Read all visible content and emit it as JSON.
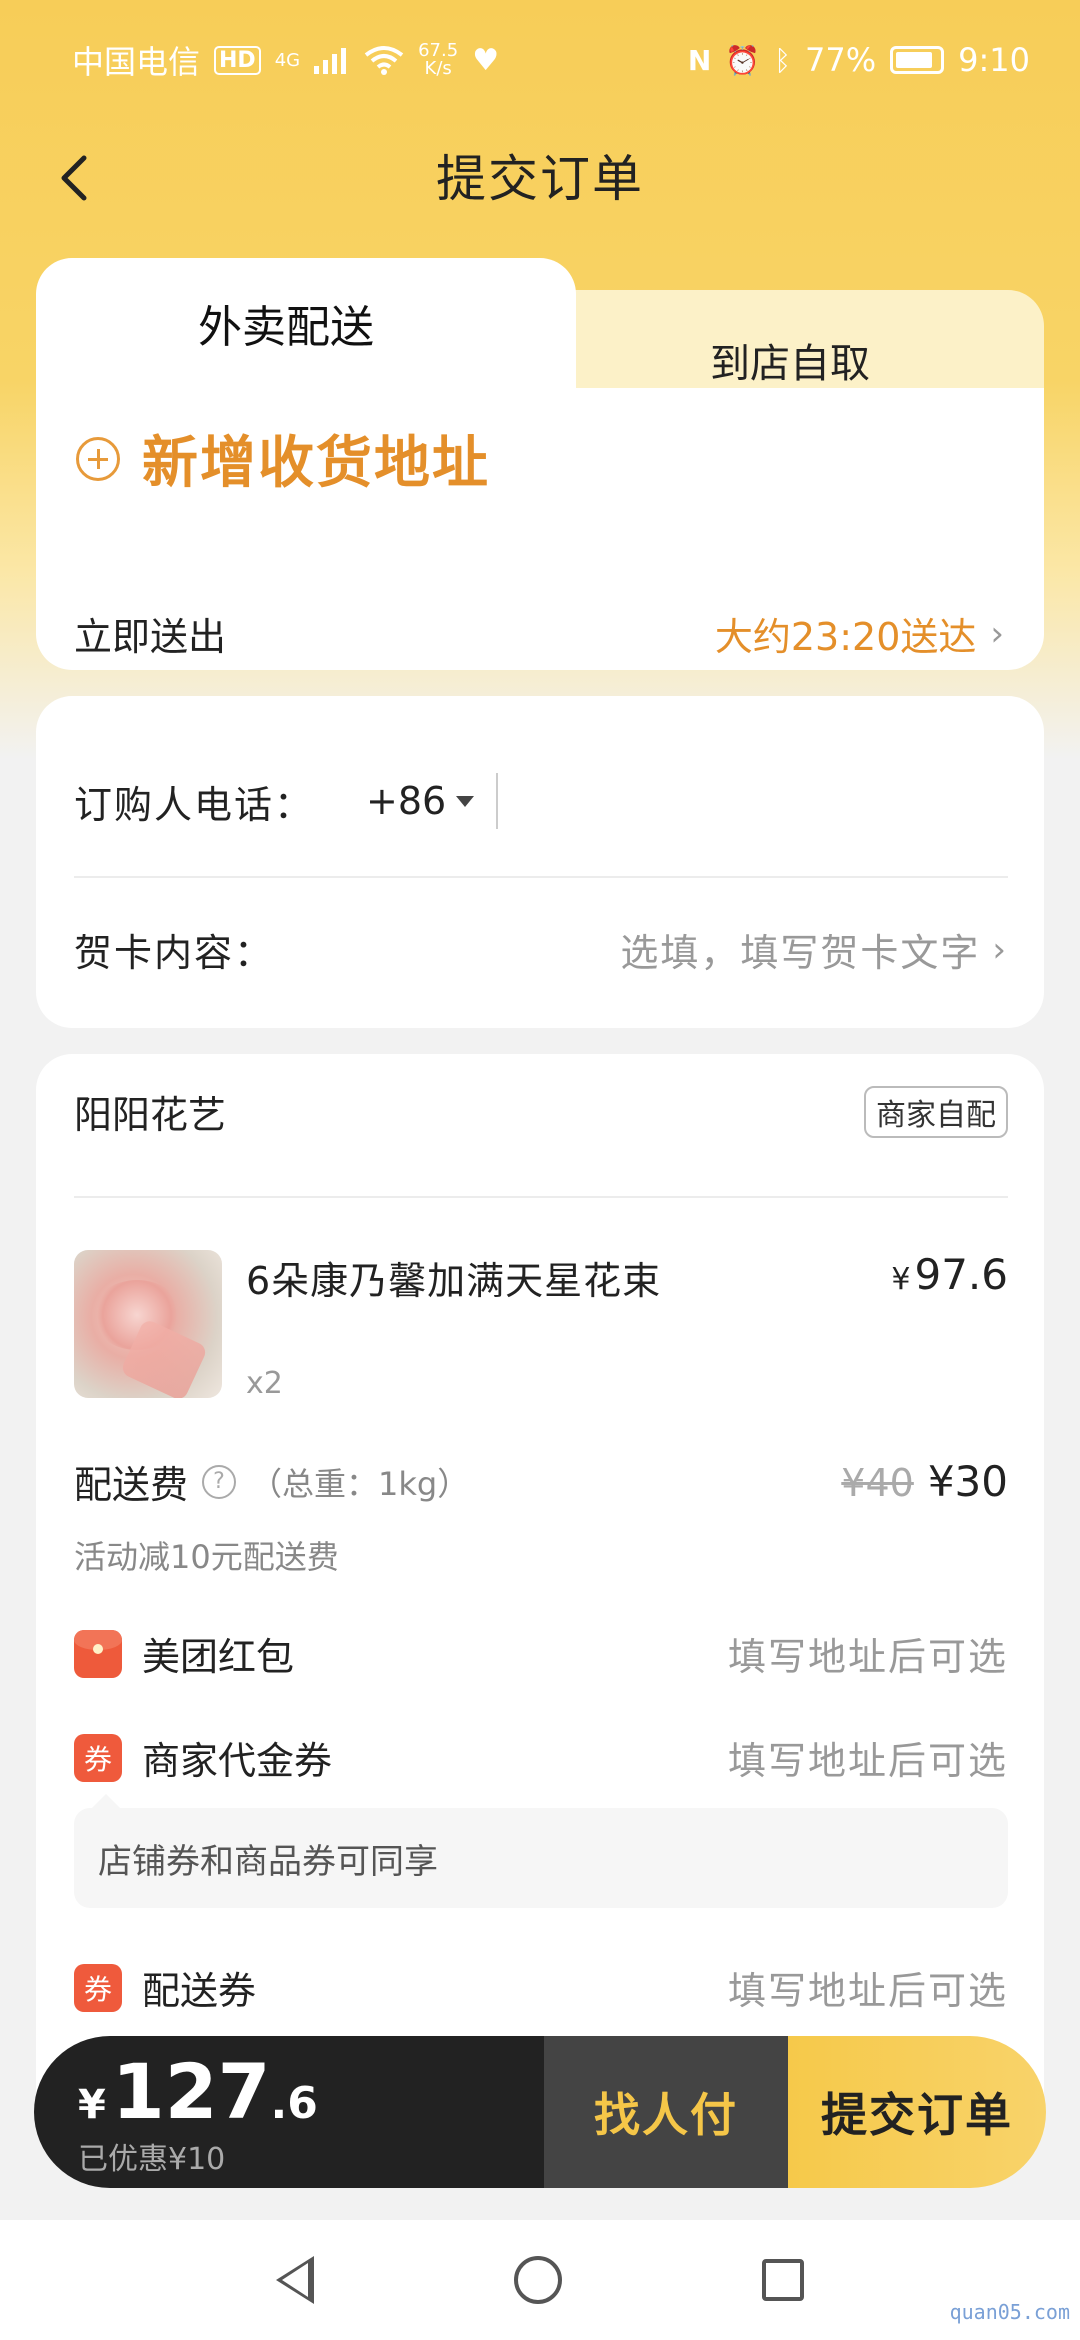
{
  "status_bar": {
    "carrier": "中国电信",
    "hd": "HD",
    "network": "4G",
    "speed_value": "67.5",
    "speed_unit": "K/s",
    "battery": "77%",
    "time": "9:10"
  },
  "header": {
    "title": "提交订单"
  },
  "delivery": {
    "tab_active": "外卖配送",
    "tab_inactive": "到店自取",
    "add_address": "新增收货地址",
    "deliver_now": "立即送出",
    "eta": "大约23:20送达"
  },
  "contact": {
    "phone_label": "订购人电话：",
    "phone_prefix": "+86",
    "card_label": "贺卡内容：",
    "card_placeholder": "选填，填写贺卡文字"
  },
  "order": {
    "shop_name": "阳阳花艺",
    "shop_badge": "商家自配",
    "product": {
      "name": "6朵康乃馨加满天星花束",
      "qty": "x2",
      "price_symbol": "¥",
      "price": "97.6"
    },
    "delivery_fee": {
      "label": "配送费",
      "help_icon": "?",
      "weight": "（总重：1kg）",
      "original": "¥40",
      "current": "¥30",
      "note": "活动减10元配送费"
    },
    "coupons": [
      {
        "icon": "red-packet-icon",
        "label": "美团红包",
        "status": "填写地址后可选"
      },
      {
        "icon": "coupon-icon",
        "icon_text": "券",
        "label": "商家代金券",
        "status": "填写地址后可选"
      },
      {
        "icon": "coupon-icon",
        "icon_text": "券",
        "label": "配送券",
        "status": "填写地址后可选"
      }
    ],
    "tip": "店铺券和商品券可同享"
  },
  "bottom_bar": {
    "yen": "¥",
    "total_int": "127",
    "total_dec": ".6",
    "saved": "已优惠¥10",
    "find_pay": "找人付",
    "submit": "提交订单"
  },
  "watermark": "quan05.com",
  "colors": {
    "brand_yellow": "#f7cd58",
    "accent_orange": "#e48f2a",
    "coupon_red": "#ef5a3c",
    "dark_bar": "#222222"
  }
}
